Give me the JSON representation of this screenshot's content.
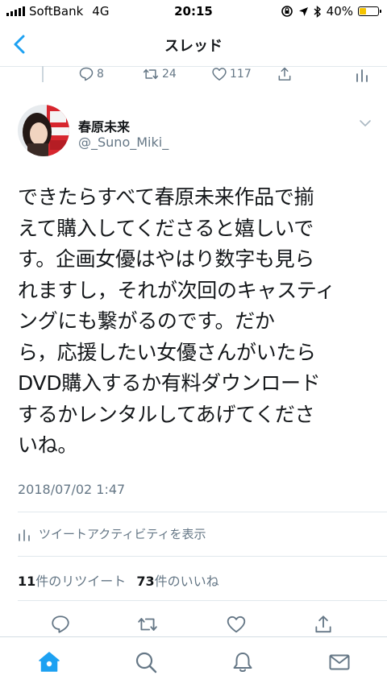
{
  "status_bar": {
    "carrier": "SoftBank",
    "network": "4G",
    "time": "20:15",
    "battery_percent": "40%",
    "battery_level": 0.4,
    "battery_color": "#f5c400"
  },
  "nav": {
    "title": "スレッド",
    "back_icon": "chevron-left-icon"
  },
  "previous_tweet": {
    "replies": "8",
    "retweets": "24",
    "likes": "117"
  },
  "tweet": {
    "author_name": "春原未来",
    "author_handle": "@_Suno_Miki_",
    "text": "できたらすべて春原未来作品で揃\nえて購入してくださると嬉しいで\nす。企画女優はやはり数字も見ら\nれますし，それが次回のキャスティ\nングにも繋がるのです。だか\nら，応援したい女優さんがいたら\nDVD購入するか有料ダウンロード\nするかレンタルしてあげてくださ\nいね。",
    "timestamp": "2018/07/02 1:47",
    "activity_label": "ツイートアクティビティを表示",
    "retweet_count": "11",
    "retweet_suffix": "件のリツイート",
    "like_count": "73",
    "like_suffix": "件のいいね"
  },
  "colors": {
    "accent": "#1da1f2",
    "muted": "#657786",
    "text": "#14171a",
    "divider": "#e1e8ed"
  },
  "tab_bar": [
    "home-icon",
    "search-icon",
    "notifications-icon",
    "messages-icon"
  ]
}
